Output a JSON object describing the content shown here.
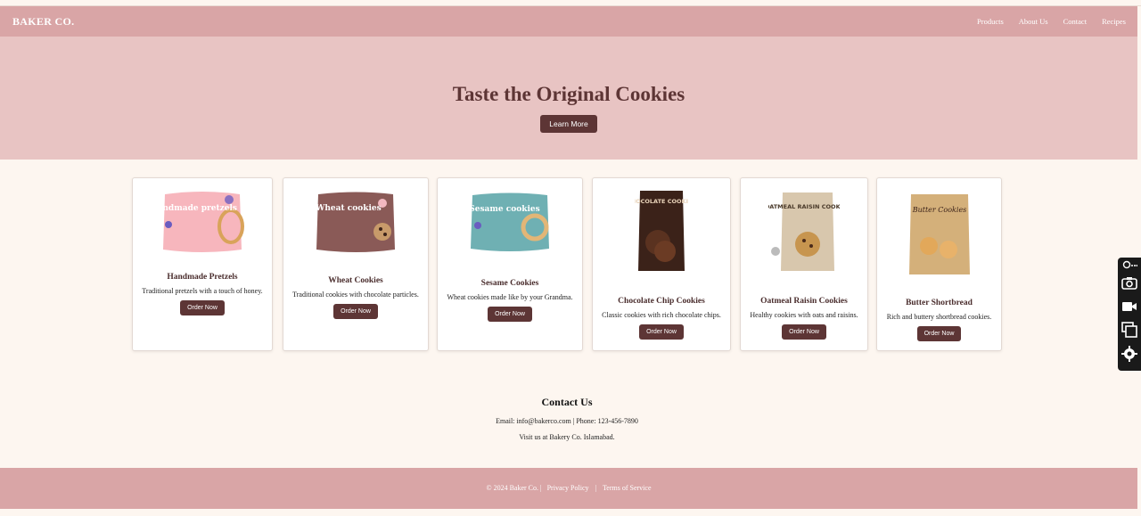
{
  "brand": "BAKER CO.",
  "nav": {
    "items": [
      "Products",
      "About Us",
      "Contact",
      "Recipes"
    ]
  },
  "hero": {
    "title": "Taste the Original Cookies",
    "button": "Learn More"
  },
  "products": [
    {
      "name": "Handmade Pretzels",
      "desc": "Traditional pretzels with a touch of honey.",
      "button": "Order Now",
      "pack_text": "Handmade pretzels",
      "pack_color": "#f7b6bd"
    },
    {
      "name": "Wheat Cookies",
      "desc": "Traditional cookies with chocolate particles.",
      "button": "Order Now",
      "pack_text": "Wheat cookies",
      "pack_color": "#8a5a57"
    },
    {
      "name": "Sesame Cookies",
      "desc": "Wheat cookies made like by your Grandma.",
      "button": "Order Now",
      "pack_text": "Sesame cookies",
      "pack_color": "#6fb0b3"
    },
    {
      "name": "Chocolate Chip Cookies",
      "desc": "Classic cookies with rich chocolate chips.",
      "button": "Order Now",
      "pack_text": "CHOCOLATE COOKIES",
      "pack_color": "#3b2219"
    },
    {
      "name": "Oatmeal Raisin Cookies",
      "desc": "Healthy cookies with oats and raisins.",
      "button": "Order Now",
      "pack_text": "OATMEAL RAISIN COOKIES",
      "pack_color": "#d8c7ad"
    },
    {
      "name": "Butter Shortbread",
      "desc": "Rich and buttery shortbread cookies.",
      "button": "Order Now",
      "pack_text": "Butter Cookies",
      "pack_color": "#d4b07a"
    }
  ],
  "contact": {
    "title": "Contact Us",
    "line1": "Email: info@bakerco.com | Phone: 123-456-7890",
    "line2": "Visit us at Bakery Co. Islamabad."
  },
  "footer": {
    "copyright": "© 2024 Baker Co. |",
    "privacy": "Privacy Policy",
    "separator": "|",
    "terms": "Terms of Service"
  },
  "colors": {
    "nav_bg": "#d9a5a6",
    "hero_bg": "#e8c4c3",
    "button_bg": "#5d3535",
    "page_bg": "#fdf6f0"
  },
  "toolbar_icons": [
    "pin-more-icon",
    "camera-icon",
    "video-icon",
    "windows-icon",
    "gear-icon"
  ]
}
